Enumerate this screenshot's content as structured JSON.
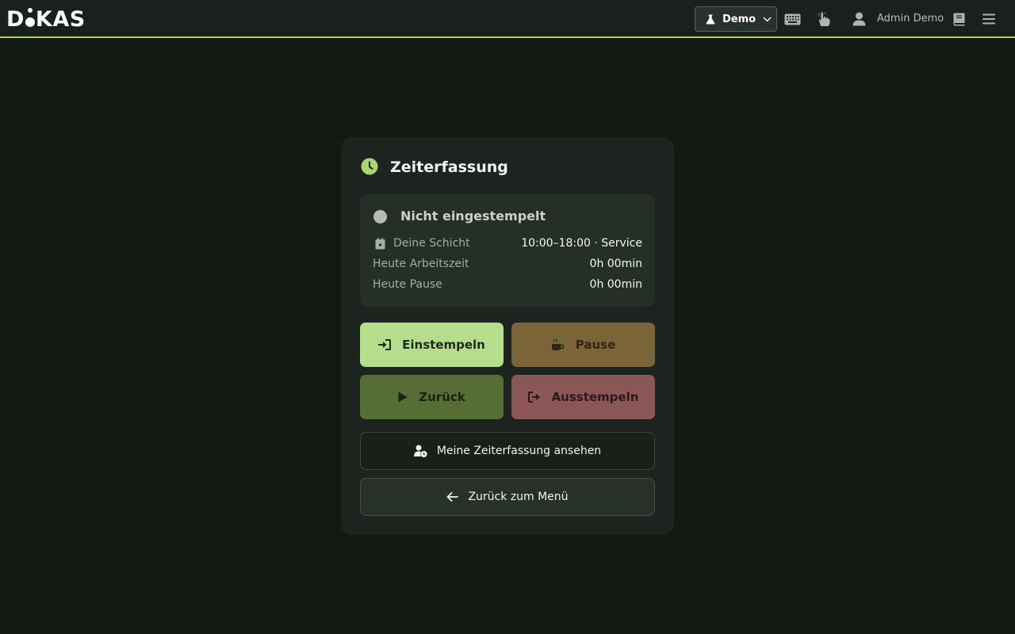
{
  "header": {
    "logo_text_left": "D",
    "logo_text_right": "KAS",
    "environment_select": "Demo",
    "user_name": "Admin Demo",
    "icons": [
      "flask-icon",
      "chevron-down-icon",
      "keyboard-icon",
      "touch-icon",
      "user-icon",
      "book-icon",
      "menu-icon"
    ]
  },
  "card": {
    "title": "Zeiterfassung",
    "status": {
      "text": "Nicht eingestempelt",
      "rows": [
        {
          "label": "Deine Schicht",
          "value": "10:00–18:00 · Service"
        },
        {
          "label": "Heute Arbeitszeit",
          "value": "0h 00min"
        },
        {
          "label": "Heute Pause",
          "value": "0h 00min"
        }
      ]
    },
    "buttons": {
      "clock_in": "Einstempeln",
      "pause": "Pause",
      "back": "Zurück",
      "clock_out": "Ausstempeln",
      "view_records": "Meine Zeiterfassung ansehen",
      "back_to_menu": "Zurück zum Menü"
    }
  },
  "colors": {
    "accent": "#9ed46a",
    "clock_in": "#b5de8c",
    "pause": "#7a6438",
    "back": "#566e35",
    "clock_out": "#8a5656",
    "background": "#131813",
    "card": "#1d231e"
  }
}
